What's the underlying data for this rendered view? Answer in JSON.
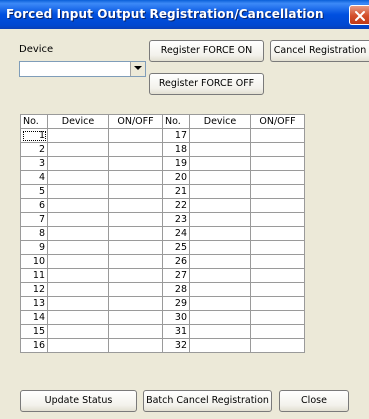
{
  "window": {
    "title": "Forced Input Output Registration/Cancellation"
  },
  "device_label": "Device",
  "device_combo": {
    "value": ""
  },
  "buttons": {
    "register_force_on": "Register FORCE ON",
    "cancel_registration": "Cancel Registration",
    "register_force_off": "Register FORCE OFF",
    "update_status": "Update Status",
    "batch_cancel": "Batch Cancel Registration",
    "close": "Close"
  },
  "table": {
    "headers": [
      "No.",
      "Device",
      "ON/OFF",
      "No.",
      "Device",
      "ON/OFF"
    ],
    "rows": [
      {
        "left_no": "1",
        "right_no": "17"
      },
      {
        "left_no": "2",
        "right_no": "18"
      },
      {
        "left_no": "3",
        "right_no": "19"
      },
      {
        "left_no": "4",
        "right_no": "20"
      },
      {
        "left_no": "5",
        "right_no": "21"
      },
      {
        "left_no": "6",
        "right_no": "22"
      },
      {
        "left_no": "7",
        "right_no": "23"
      },
      {
        "left_no": "8",
        "right_no": "24"
      },
      {
        "left_no": "9",
        "right_no": "25"
      },
      {
        "left_no": "10",
        "right_no": "26"
      },
      {
        "left_no": "11",
        "right_no": "27"
      },
      {
        "left_no": "12",
        "right_no": "28"
      },
      {
        "left_no": "13",
        "right_no": "29"
      },
      {
        "left_no": "14",
        "right_no": "30"
      },
      {
        "left_no": "15",
        "right_no": "31"
      },
      {
        "left_no": "16",
        "right_no": "32"
      }
    ]
  },
  "colors": {
    "titlebar": "#0050e0",
    "dialog_bg": "#ece9d8",
    "close_button": "#d34d2a"
  },
  "icons": {
    "close": "close-icon",
    "dropdown": "chevron-down-icon"
  }
}
